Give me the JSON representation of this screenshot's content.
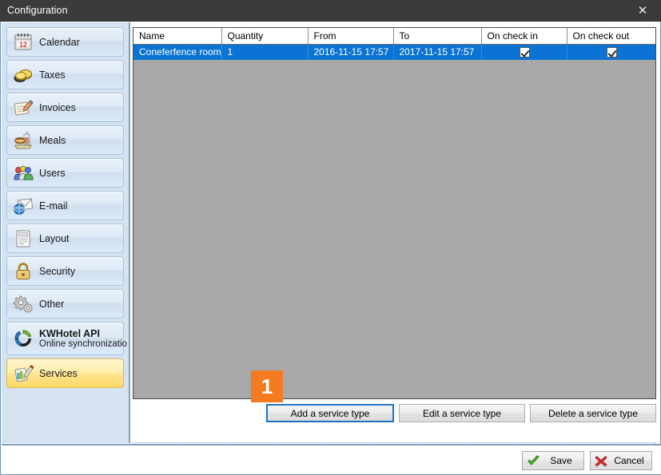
{
  "window": {
    "title": "Configuration",
    "close_label": "✕"
  },
  "sidebar": {
    "items": [
      {
        "label": "Calendar",
        "icon": "calendar-icon",
        "sub": "",
        "active": false
      },
      {
        "label": "Taxes",
        "icon": "coins-icon",
        "sub": "",
        "active": false
      },
      {
        "label": "Invoices",
        "icon": "invoice-icon",
        "sub": "",
        "active": false
      },
      {
        "label": "Meals",
        "icon": "meals-icon",
        "sub": "",
        "active": false
      },
      {
        "label": "Users",
        "icon": "users-icon",
        "sub": "",
        "active": false
      },
      {
        "label": "E-mail",
        "icon": "email-icon",
        "sub": "",
        "active": false
      },
      {
        "label": "Layout",
        "icon": "layout-icon",
        "sub": "",
        "active": false
      },
      {
        "label": "Security",
        "icon": "lock-icon",
        "sub": "",
        "active": false
      },
      {
        "label": "Other",
        "icon": "gears-icon",
        "sub": "",
        "active": false
      },
      {
        "label": "KWHotel API",
        "icon": "sync-icon",
        "sub": "Online synchronizatio",
        "active": false
      },
      {
        "label": "Services",
        "icon": "services-icon",
        "sub": "",
        "active": true
      }
    ]
  },
  "grid": {
    "columns": [
      "Name",
      "Quantity",
      "From",
      "To",
      "On check in",
      "On check out"
    ],
    "rows": [
      {
        "name": "Coneferfence room",
        "quantity": "1",
        "from": "2016-11-15 17:57",
        "to": "2017-11-15 17:57",
        "on_check_in": true,
        "on_check_out": true,
        "selected": true
      }
    ]
  },
  "annotation": {
    "step_number": "1"
  },
  "actions": {
    "add_label": "Add a service type",
    "edit_label": "Edit a service type",
    "delete_label": "Delete a service type"
  },
  "iconbar": {
    "items": [
      "calendar-icon",
      "coins-icon",
      "invoice-icon",
      "meals-icon",
      "users-icon",
      "email-icon",
      "layout-icon",
      "lock-icon",
      "gears-icon",
      "sync-icon",
      "services-icon"
    ],
    "selected_index": 10
  },
  "footer": {
    "save_label": "Save",
    "cancel_label": "Cancel"
  },
  "colors": {
    "titlebar": "#3b3b3b",
    "sidebar_bg": "#d5e2f0",
    "active_item": "#ffd867",
    "grid_bg": "#a8a8a8",
    "selection": "#0a73d4",
    "badge": "#f47b20",
    "focus_border": "#1b74c4"
  }
}
